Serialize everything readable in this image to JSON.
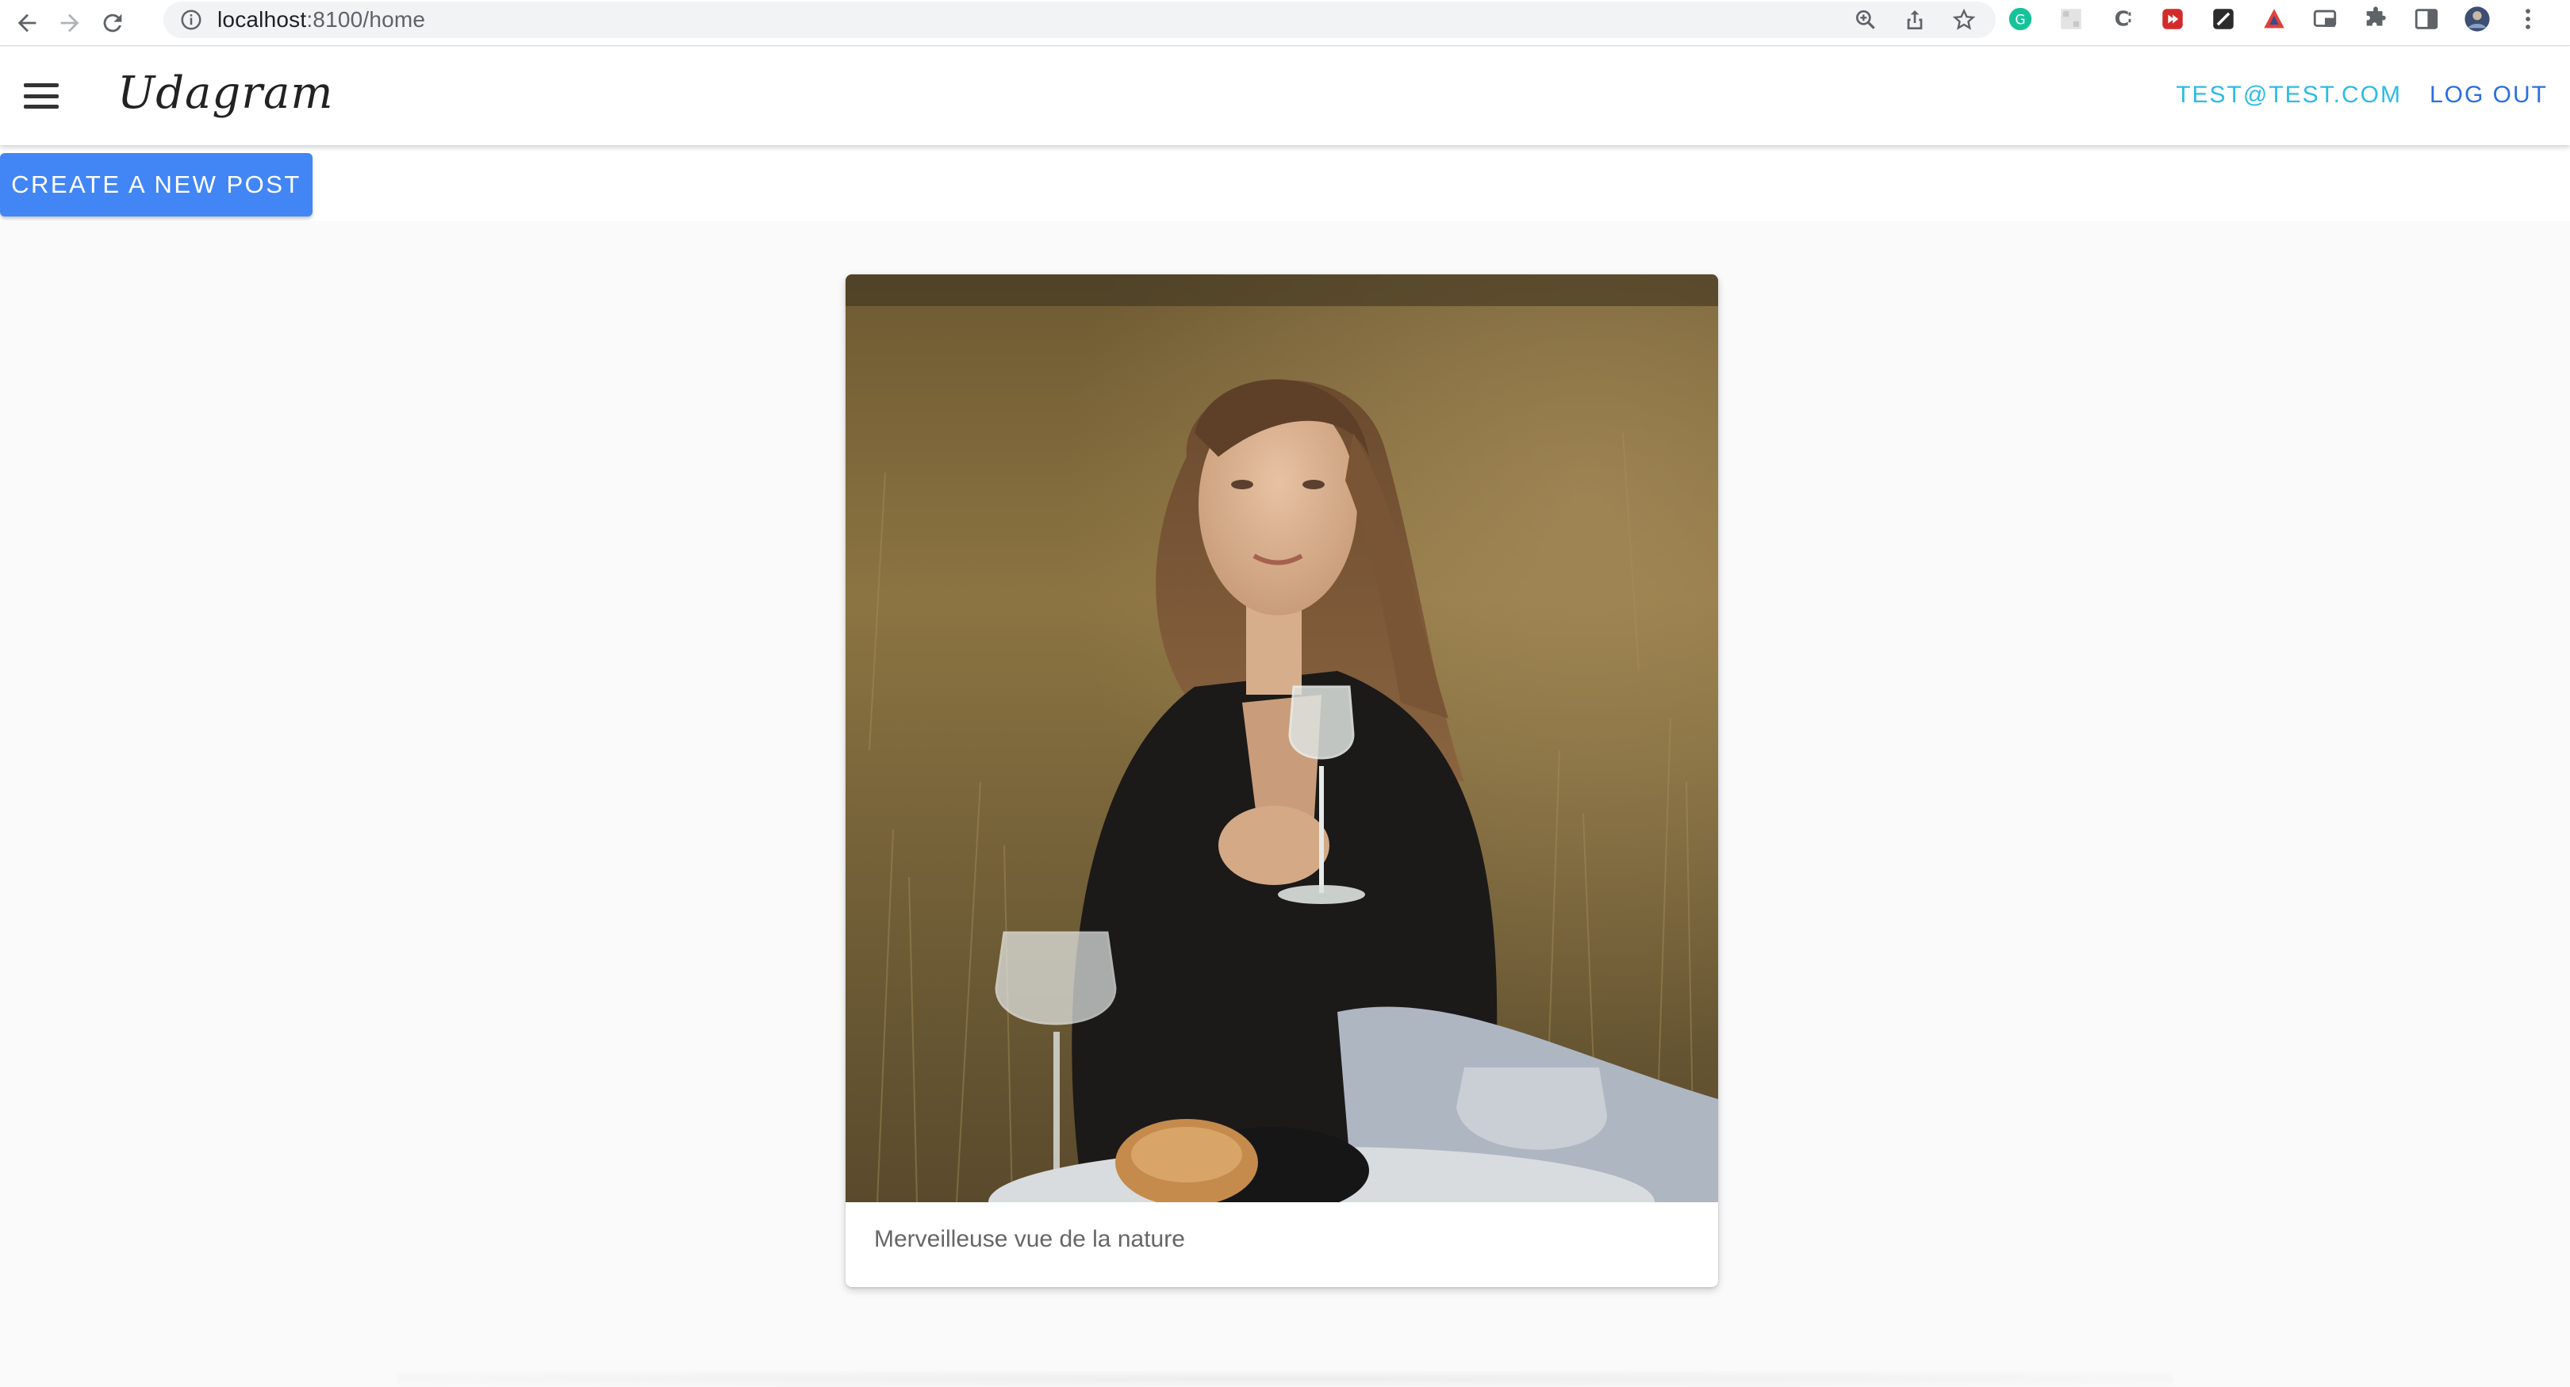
{
  "browser": {
    "url_host": "localhost",
    "url_rest": ":8100/home",
    "icons": [
      "back-arrow-icon",
      "forward-arrow-icon",
      "reload-icon",
      "info-icon",
      "zoom-icon",
      "share-icon",
      "star-icon"
    ],
    "extensions": [
      "grammarly-extension-icon",
      "qr-extension-icon",
      "css-extension-icon",
      "video-extension-icon",
      "dark-extension-icon",
      "vpn-extension-icon",
      "cast-extension-icon",
      "puzzle-icon",
      "sidepanel-icon",
      "profile-avatar",
      "kebab-menu-icon"
    ]
  },
  "toolbar": {
    "brand": "Udagram",
    "user_email": "TEST@TEST.COM",
    "logout_label": "LOG OUT"
  },
  "actions": {
    "create_post_label": "CREATE A NEW POST"
  },
  "posts": [
    {
      "caption": "Merveilleuse vue de la nature"
    }
  ],
  "colors": {
    "primary_button": "#4286f6",
    "email_link": "#2dbbe6",
    "logout_link": "#2b6fe0",
    "page_bg": "#fafafa"
  }
}
